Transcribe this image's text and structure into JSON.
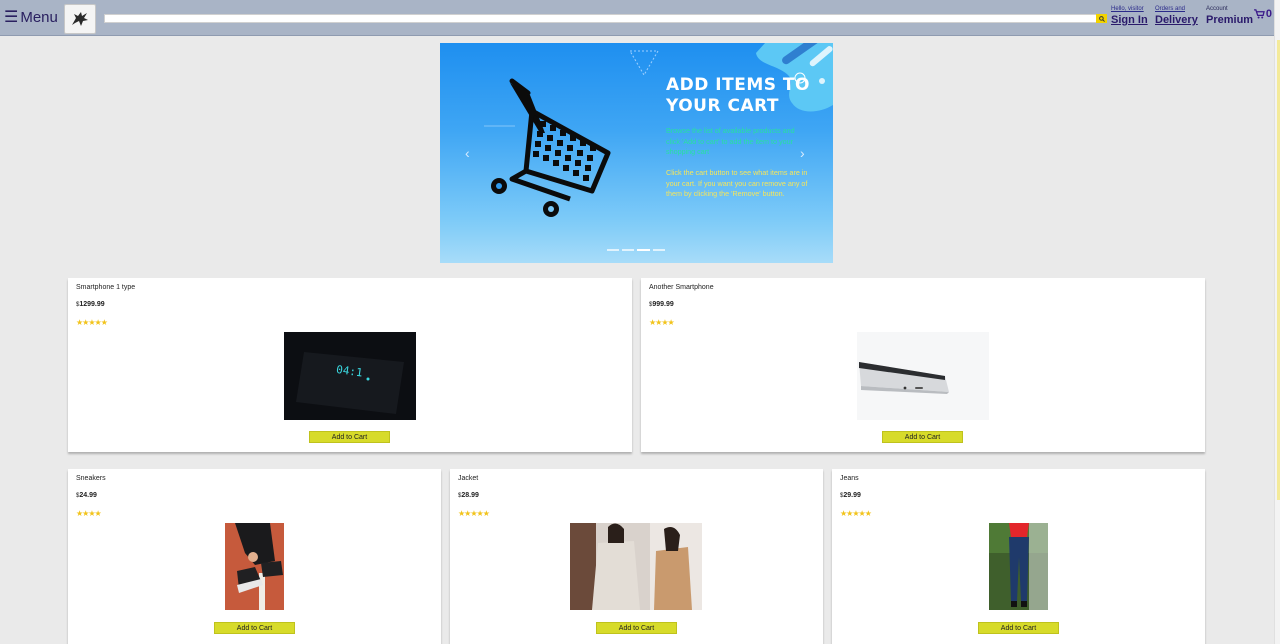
{
  "header": {
    "menu_label": "Menu",
    "search_placeholder": "",
    "greeting": "Hello, visitor",
    "sign_in": "Sign In",
    "orders_small": "Orders and",
    "orders_big": "Delivery",
    "account_small": "Account",
    "account_big": "Premium",
    "cart_count": "0"
  },
  "banner": {
    "title_line1": "ADD ITEMS TO",
    "title_line2": "YOUR CART",
    "text1": "Browse the list of available products and click 'Add to cart' to add the item to your shopping cart",
    "text2": "Click the cart button to see what items are in your cart. If you want you can remove any of them by clicking the 'Remove' button.",
    "prev": "‹",
    "next": "›"
  },
  "products": [
    {
      "name": "Smartphone 1 type",
      "currency": "$",
      "price": "1299.99",
      "stars": "★★★★★",
      "button": "Add to Cart"
    },
    {
      "name": "Another Smartphone",
      "currency": "$",
      "price": "999.99",
      "stars": "★★★★",
      "button": "Add to Cart"
    },
    {
      "name": "Sneakers",
      "currency": "$",
      "price": "24.99",
      "stars": "★★★★",
      "button": "Add to Cart"
    },
    {
      "name": "Jacket",
      "currency": "$",
      "price": "28.99",
      "stars": "★★★★★",
      "button": "Add to Cart"
    },
    {
      "name": "Jeans",
      "currency": "$",
      "price": "29.99",
      "stars": "★★★★★",
      "button": "Add to Cart"
    }
  ],
  "colors": {
    "header_bg": "#a9b4c6",
    "accent_button": "#d7db2a",
    "star": "#f2c31a",
    "page_bg": "#eaeaea"
  }
}
